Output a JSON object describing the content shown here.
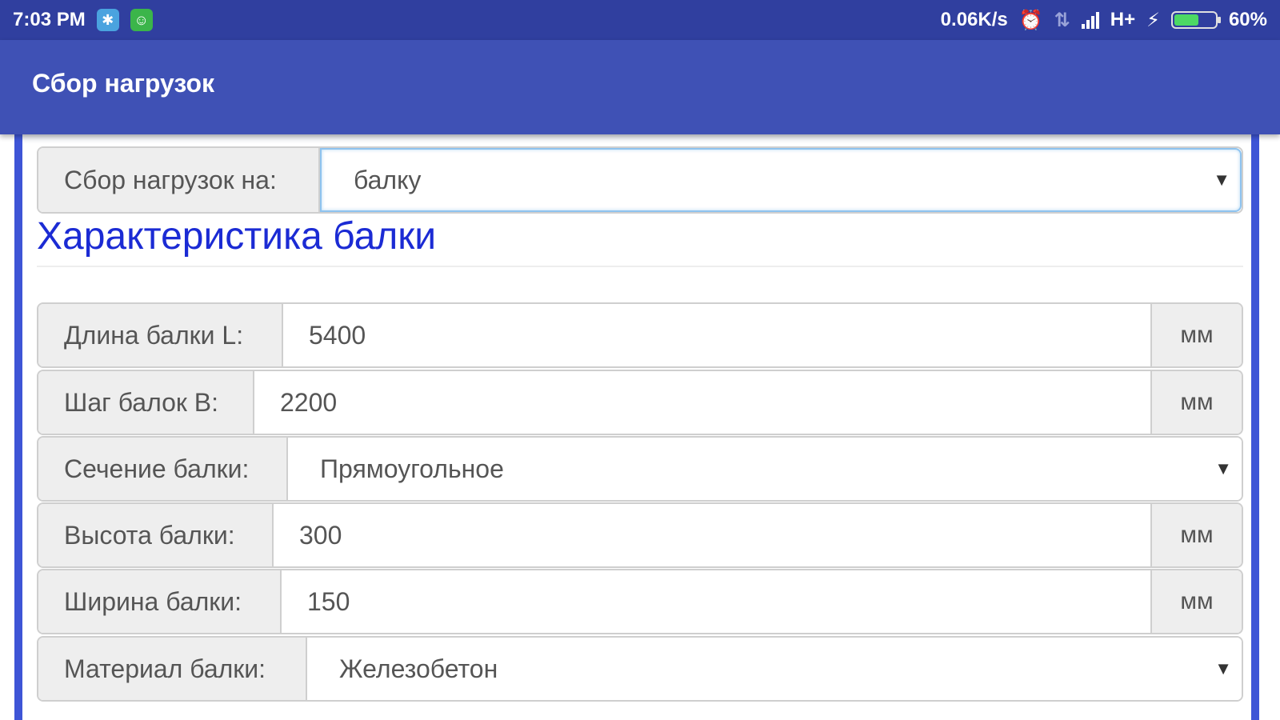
{
  "status_bar": {
    "time": "7:03 PM",
    "speed": "0.06K/s",
    "network": "H+",
    "battery_percent": "60%",
    "battery_level": 0.6,
    "icons": [
      "app-notification-icon",
      "android-icon",
      "alarm-icon",
      "data-transfer-icon",
      "signal-icon",
      "charging-icon",
      "battery-icon"
    ]
  },
  "app_bar": {
    "title": "Сбор нагрузок",
    "color": "#3f51b5"
  },
  "load_target": {
    "label": "Сбор нагрузок на:",
    "selected": "балку"
  },
  "section": {
    "title": "Характеристика балки",
    "title_color": "#1b2bd4"
  },
  "fields": [
    {
      "label": "Длина балки L:",
      "value": "5400",
      "unit": "мм",
      "type": "number"
    },
    {
      "label": "Шаг балок B:",
      "value": "2200",
      "unit": "мм",
      "type": "number"
    },
    {
      "label": "Сечение балки:",
      "value": "Прямоугольное",
      "type": "select"
    },
    {
      "label": "Высота балки:",
      "value": "300",
      "unit": "мм",
      "type": "number"
    },
    {
      "label": "Ширина балки:",
      "value": "150",
      "unit": "мм",
      "type": "number"
    },
    {
      "label": "Материал балки:",
      "value": "Железобетон",
      "type": "select"
    }
  ],
  "caret_glyph": "▼"
}
